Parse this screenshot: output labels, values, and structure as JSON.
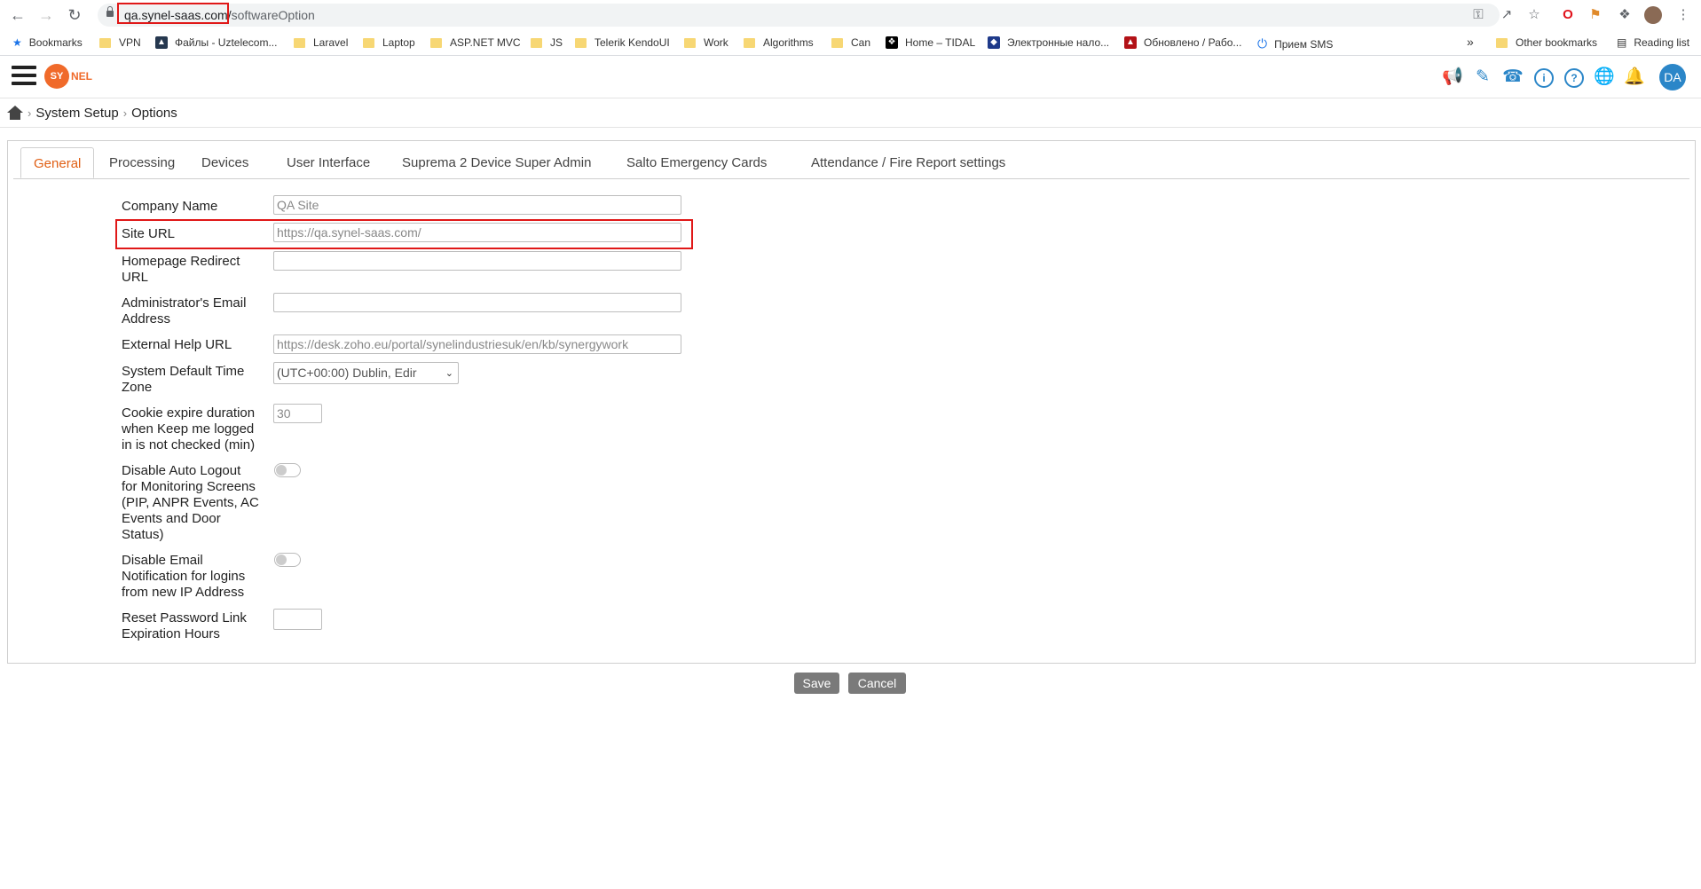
{
  "browser": {
    "url_host": "qa.synel-saas.com/",
    "url_path": "softwareOption",
    "bookmarks": [
      {
        "label": "Bookmarks",
        "icon": "star-icon"
      },
      {
        "label": "VPN",
        "icon": "folder-icon"
      },
      {
        "label": "Файлы - Uztelecom...",
        "icon": "site-icon"
      },
      {
        "label": "Laravel",
        "icon": "folder-icon"
      },
      {
        "label": "Laptop",
        "icon": "folder-icon"
      },
      {
        "label": "ASP.NET MVC",
        "icon": "folder-icon"
      },
      {
        "label": "JS",
        "icon": "folder-icon"
      },
      {
        "label": "Telerik KendoUI",
        "icon": "folder-icon"
      },
      {
        "label": "Work",
        "icon": "folder-icon"
      },
      {
        "label": "Algorithms",
        "icon": "folder-icon"
      },
      {
        "label": "Can",
        "icon": "folder-icon"
      },
      {
        "label": "Home – TIDAL",
        "icon": "tidal-icon"
      },
      {
        "label": "Электронные нало...",
        "icon": "tax-icon"
      },
      {
        "label": "Обновлено / Рабо...",
        "icon": "red-icon"
      },
      {
        "label": "Прием SMS",
        "icon": "power-icon"
      }
    ],
    "more_label": "»",
    "other_bookmarks": "Other bookmarks",
    "reading_list": "Reading list"
  },
  "app": {
    "logo_text": "SY",
    "logo_rest": "NEL",
    "avatar_initials": "DA"
  },
  "breadcrumb": {
    "items": [
      "System Setup",
      "Options"
    ]
  },
  "tabs": [
    "General",
    "Processing",
    "Devices",
    "User Interface",
    "Suprema 2 Device Super Admin",
    "Salto Emergency Cards",
    "Attendance / Fire Report settings"
  ],
  "form": {
    "company_name_label": "Company Name",
    "company_name_value": "QA Site",
    "site_url_label": "Site URL",
    "site_url_value": "https://qa.synel-saas.com/",
    "homepage_redirect_label_1": "Homepage Redirect",
    "homepage_redirect_label_2": "URL",
    "admin_email_label_1": "Administrator's Email",
    "admin_email_label_2": "Address",
    "external_help_label": "External Help URL",
    "external_help_value": "https://desk.zoho.eu/portal/synelindustriesuk/en/kb/synergywork",
    "timezone_label_1": "System Default Time",
    "timezone_label_2": "Zone",
    "timezone_value": "(UTC+00:00) Dublin, Edir",
    "cookie_label_1": "Cookie expire duration",
    "cookie_label_2": "when Keep me logged",
    "cookie_label_3": "in is not checked (min)",
    "cookie_value": "30",
    "auto_logout_label_1": "Disable Auto Logout",
    "auto_logout_label_2": "for Monitoring Screens",
    "auto_logout_label_3": "(PIP, ANPR Events, AC",
    "auto_logout_label_4": "Events and Door",
    "auto_logout_label_5": "Status)",
    "email_notif_label_1": "Disable Email",
    "email_notif_label_2": "Notification for logins",
    "email_notif_label_3": "from new IP Address",
    "reset_pw_label_1": "Reset Password Link",
    "reset_pw_label_2": "Expiration Hours"
  },
  "actions": {
    "save": "Save",
    "cancel": "Cancel"
  }
}
